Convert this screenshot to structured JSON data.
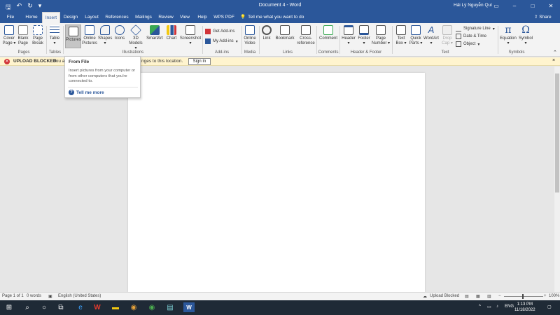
{
  "titlebar": {
    "document_title": "Document 4  -  Word",
    "user_name": "Hải Lý Nguyễn Quí",
    "undo_icon": "undo-icon",
    "redo_icon": "redo-icon",
    "save_icon": "save-icon"
  },
  "tabs": [
    "File",
    "Home",
    "Insert",
    "Design",
    "Layout",
    "References",
    "Mailings",
    "Review",
    "View",
    "Help",
    "WPS PDF"
  ],
  "active_tab": "Insert",
  "tell_me": "Tell me what you want to do",
  "share": "Share",
  "ribbon": {
    "pages": {
      "cover": [
        "Cover",
        "Page ▾"
      ],
      "blank": [
        "Blank",
        "Page"
      ],
      "break": [
        "Page",
        "Break"
      ],
      "group": "Pages"
    },
    "tables": {
      "table": [
        "Table",
        "▾"
      ],
      "group": "Tables"
    },
    "illustrations": {
      "pictures": "Pictures",
      "online_pictures": [
        "Online",
        "Pictures"
      ],
      "shapes": [
        "Shapes",
        "▾"
      ],
      "icons": "Icons",
      "models": [
        "3D",
        "Models ▾"
      ],
      "smartart": "SmartArt",
      "chart": "Chart",
      "screenshot": [
        "Screenshot",
        "▾"
      ],
      "group": "Illustrations"
    },
    "addins": {
      "get": "Get Add-ins",
      "my": "My Add-ins",
      "group": "Add-ins"
    },
    "media": {
      "online_video": [
        "Online",
        "Video"
      ],
      "group": "Media"
    },
    "links": {
      "link": "Link",
      "bookmark": "Bookmark",
      "cross": [
        "Cross-",
        "reference"
      ],
      "group": "Links"
    },
    "comments": {
      "comment": "Comment",
      "group": "Comments"
    },
    "header_footer": {
      "header": [
        "Header",
        "▾"
      ],
      "footer": [
        "Footer",
        "▾"
      ],
      "page_number": [
        "Page",
        "Number ▾"
      ],
      "group": "Header & Footer"
    },
    "text": {
      "text_box": [
        "Text",
        "Box ▾"
      ],
      "quick_parts": [
        "Quick",
        "Parts ▾"
      ],
      "wordart": [
        "WordArt",
        "▾"
      ],
      "drop_cap": [
        "Drop",
        "Cap ▾"
      ],
      "signature_line": "Signature Line",
      "date_time": "Date & Time",
      "object": "Object",
      "group": "Text"
    },
    "symbols": {
      "equation": [
        "Equation",
        "▾"
      ],
      "symbol": [
        "Symbol",
        "▾"
      ],
      "group": "Symbols"
    }
  },
  "message_bar": {
    "title": "UPLOAD BLOCKED",
    "text": "You a",
    "text_tail": "nges to this location.",
    "button": "Sign In"
  },
  "tooltip": {
    "title": "From File",
    "body": "Insert pictures from your computer or from other computers that you're connected to.",
    "more": "Tell me more"
  },
  "status": {
    "page": "Page 1 of 1",
    "words": "0 words",
    "language": "English (United States)",
    "upload": "Upload Blocked",
    "zoom": "100%"
  },
  "taskbar": {
    "language": "ENG",
    "time": "1:13 PM",
    "date": "11/18/2022"
  },
  "colors": {
    "accent": "#2b579a",
    "warning_bg": "#fff4ce"
  }
}
